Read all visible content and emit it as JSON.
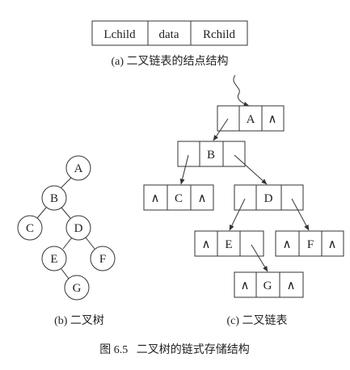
{
  "node_structure": {
    "fields": [
      "Lchild",
      "data",
      "Rchild"
    ],
    "caption": "(a) 二叉链表的结点结构"
  },
  "binary_tree": {
    "nodes": [
      "A",
      "B",
      "C",
      "D",
      "E",
      "F",
      "G"
    ],
    "edges": [
      [
        "A",
        "B"
      ],
      [
        "B",
        "C"
      ],
      [
        "B",
        "D"
      ],
      [
        "D",
        "E"
      ],
      [
        "D",
        "F"
      ],
      [
        "E",
        "G"
      ]
    ],
    "caption": "(b) 二叉树"
  },
  "linked_list": {
    "null_symbol": "∧",
    "nodes": [
      {
        "data": "A",
        "left": "B",
        "right": "∧"
      },
      {
        "data": "B",
        "left": "C",
        "right": "D"
      },
      {
        "data": "C",
        "left": "∧",
        "right": "∧"
      },
      {
        "data": "D",
        "left": "E",
        "right": "F"
      },
      {
        "data": "E",
        "left": "∧",
        "right": "G"
      },
      {
        "data": "F",
        "left": "∧",
        "right": "∧"
      },
      {
        "data": "G",
        "left": "∧",
        "right": "∧"
      }
    ],
    "caption": "(c) 二叉链表"
  },
  "figure_caption": "图 6.5   二叉树的链式存储结构"
}
